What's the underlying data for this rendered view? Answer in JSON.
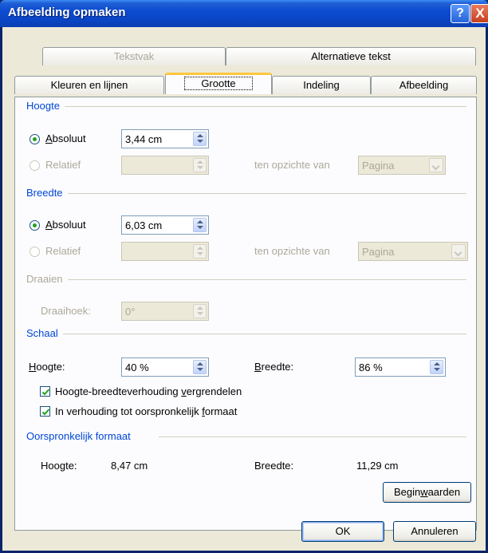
{
  "window": {
    "title": "Afbeelding opmaken",
    "help_label": "?",
    "close_label": "X"
  },
  "tabs": {
    "row1": [
      "Tekstvak",
      "Alternatieve tekst"
    ],
    "row2": [
      "Kleuren en lijnen",
      "Grootte",
      "Indeling",
      "Afbeelding"
    ],
    "active": "Grootte"
  },
  "hoogte": {
    "section": "Hoogte",
    "absolute_label_u": "A",
    "absolute_label_rest": "bsoluut",
    "absolute_value": "3,44 cm",
    "relative_label": "Relatief",
    "relative_value": "",
    "relative_to_label": "ten opzichte van",
    "relative_to_value": "Pagina"
  },
  "breedte": {
    "section": "Breedte",
    "absolute_label_u": "A",
    "absolute_label_rest": "bsoluut",
    "absolute_value": "6,03 cm",
    "relative_label": "Relatief",
    "relative_value": "",
    "relative_to_label": "ten opzichte van",
    "relative_to_value": "Pagina"
  },
  "draaien": {
    "section": "Draaien",
    "angle_label": "Draaihoek:",
    "angle_value": "0°"
  },
  "schaal": {
    "section": "Schaal",
    "height_label_u": "H",
    "height_label_rest": "oogte:",
    "height_value": "40 %",
    "width_label_u": "B",
    "width_label_rest": "reedte:",
    "width_value": "86 %",
    "lock_ratio_pre": "Hoogte-breedteverhouding ",
    "lock_ratio_u": "v",
    "lock_ratio_post": "ergrendelen",
    "lock_ratio_checked": true,
    "relative_original_pre": "In verhouding tot oorspronkelijk ",
    "relative_original_u": "f",
    "relative_original_post": "ormaat",
    "relative_original_checked": true
  },
  "original": {
    "section": "Oorspronkelijk formaat",
    "height_label": "Hoogte:",
    "height_value": "8,47 cm",
    "width_label": "Breedte:",
    "width_value": "11,29 cm",
    "reset_pre": "Begin",
    "reset_u": "w",
    "reset_post": "aarden"
  },
  "footer": {
    "ok_label": "OK",
    "cancel_label": "Annuleren"
  }
}
